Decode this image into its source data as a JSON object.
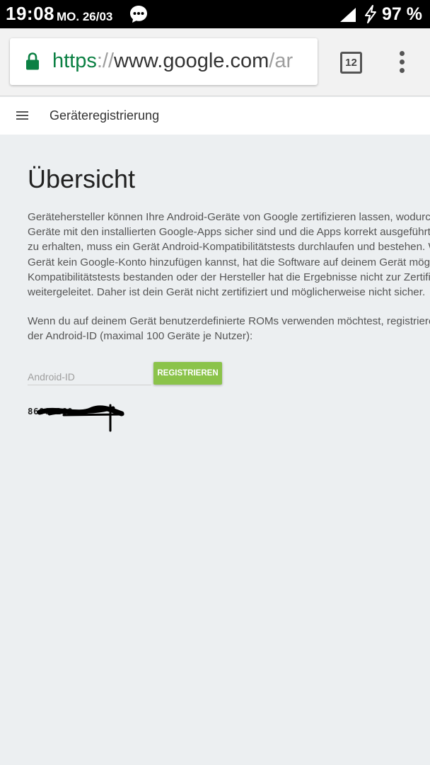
{
  "status_bar": {
    "time": "19:08",
    "date": "MO. 26/03",
    "battery": "97 %",
    "icons": [
      "message-icon",
      "signal-icon",
      "charging-icon"
    ]
  },
  "browser": {
    "url_scheme": "https",
    "url_separator": "://",
    "url_host": "www.google.com",
    "url_path": "/ar",
    "tab_count": "12",
    "accent_color": "#0b8043"
  },
  "app_header": {
    "title": "Geräteregistrierung"
  },
  "main": {
    "title": "Übersicht",
    "paragraph1_lines": [
      "Gerätehersteller können Ihre Android-Geräte von Google zertifizieren lassen, wodurch",
      "Geräte mit den installierten Google-Apps sicher sind und die Apps korrekt ausgeführt",
      "zu erhalten, muss ein Gerät Android-Kompatibilitätstests durchlaufen und bestehen. W",
      "Gerät kein Google-Konto hinzufügen kannst, hat die Software auf deinem Gerät mögli",
      "Kompatibilitätstests bestanden oder der Hersteller hat die Ergebnisse nicht zur Zertifi",
      "weitergeleitet. Daher ist dein Gerät nicht zertifiziert und möglicherweise nicht sicher."
    ],
    "paragraph2_lines": [
      "Wenn du auf deinem Gerät benutzerdefinierte ROMs verwenden möchtest, registriere",
      "der Android-ID (maximal 100 Geräte je Nutzer):"
    ],
    "input_placeholder": "Android-ID",
    "input_value": "",
    "register_label": "REGISTRIEREN",
    "register_color": "#8bc34a",
    "registered_id": "86005260"
  }
}
